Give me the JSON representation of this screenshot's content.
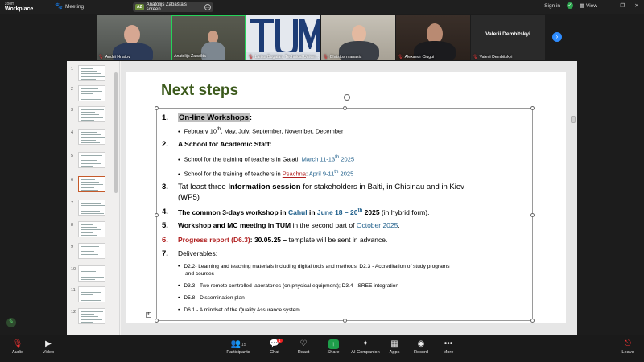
{
  "app": {
    "logo_line1": "zoom",
    "logo_line2": "Workplace",
    "meeting_label": "Meeting"
  },
  "share_pill": {
    "initials": "AZ",
    "label": "Anatolijs Zabašta's screen"
  },
  "top_right": {
    "signin": "Sign in",
    "view": "View"
  },
  "participants": [
    {
      "name": "Andrii Hnatov",
      "muted": true
    },
    {
      "name": "Anatolijs Zabašta",
      "muted": false
    },
    {
      "name": "Larisa Bugaian, Technical Univer...",
      "muted": true
    },
    {
      "name": "Christos manasis",
      "muted": true
    },
    {
      "name": "Alexandr Ciugui",
      "muted": true
    },
    {
      "name": "Valerii Dembitskyi",
      "muted": true,
      "big_label": "Valerii Dembitskyi"
    }
  ],
  "thumbnails": [
    "1",
    "2",
    "3",
    "4",
    "5",
    "6",
    "7",
    "8",
    "9",
    "10",
    "11",
    "12"
  ],
  "slide": {
    "title": "Next steps",
    "items": [
      {
        "num": "1.",
        "head_hl": "On-line Workshops",
        "head_rest": ":",
        "subs": [
          {
            "pre": "February 10",
            "sup": "th",
            "post": ", May, July, September,  November, December"
          }
        ]
      },
      {
        "num": "2.",
        "head": "A School for Academic Staff:",
        "subs": [
          {
            "pre": "School for the training of teachers in Galati: ",
            "blue1": "March 11-13",
            "sup": "th",
            "blue2": " 2025"
          },
          {
            "pre": "School for the training of teachers in ",
            "ul": "Psachna",
            "mid": ": ",
            "blue1": "April 9-11",
            "sup": "th",
            "blue2": " 2025"
          }
        ]
      },
      {
        "num": "3.",
        "line1_pre": "Tat least three ",
        "line1_bold": "Information session",
        "line1_post": " for stakeholders in Balti, in Chisinau and in Kiev",
        "line2": "(WP5)"
      },
      {
        "num": "4.",
        "bold1": "The common 3-days workshop in ",
        "ul_blue": "Cahul",
        "bold2": " in ",
        "blue": "June 18 – 20",
        "sup": "th",
        "bold3": " 2025",
        "rest": " (in hybrid form)."
      },
      {
        "num": "5.",
        "bold": "Workshop and MC meeting in TUM",
        "rest": " in the second part of ",
        "blue": "October 2025",
        "end": "."
      },
      {
        "num": "6.",
        "red": "Progress report (D6.3)",
        "bold": ": 30.05.25 –",
        "rest": " template will be sent in advance."
      },
      {
        "num": "7.",
        "head": "Deliverables:",
        "subs": [
          "D2.2- Learning and teaching materials including digital tools and methods; D2.3 - Accreditation of study programs",
          "and courses",
          "D3.3 - Two remote controlled laboratories (on physical equipment); D3.4 - SREE integration",
          "D5.8 - Dissemination plan",
          "D6.1 - A mindset of the Quality Assurance system."
        ]
      }
    ]
  },
  "toolbar": {
    "audio": "Audio",
    "video": "Video",
    "participants": "Participants",
    "participants_count": "15",
    "chat": "Chat",
    "chat_badge": "1",
    "react": "React",
    "share": "Share",
    "ai": "AI Companion",
    "apps": "Apps",
    "record": "Record",
    "more": "More",
    "leave": "Leave"
  },
  "colors": {
    "title_green": "#3c5a1c",
    "accent_blue": "#1f5f8b",
    "accent_red": "#b01e1e",
    "speaker_border": "#26d35a",
    "share_green": "#1e9e4a"
  }
}
